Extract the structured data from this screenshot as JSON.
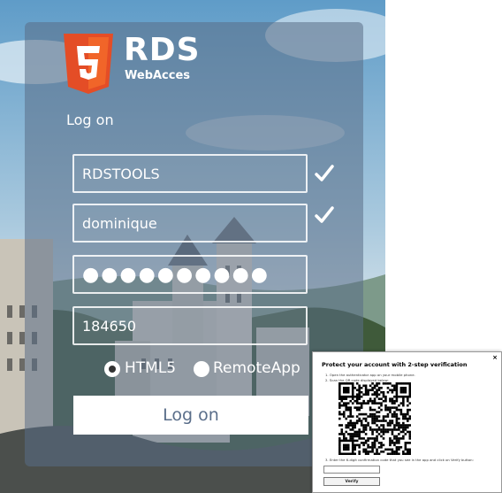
{
  "brand": {
    "title": "RDS",
    "subtitle": "WebAcces",
    "logo_icon": "html5-shield-icon",
    "logo_color": "#e44d26"
  },
  "login": {
    "heading": "Log on",
    "domain_value": "RDSTOOLS",
    "username_value": "dominique",
    "password_value": "●●●●●●●●●●",
    "code_value": "184650",
    "check_icon": "checkmark-icon",
    "radio_options": [
      {
        "label": "HTML5",
        "selected": true
      },
      {
        "label": "RemoteApp",
        "selected": false
      }
    ],
    "submit_label": "Log on"
  },
  "two_step": {
    "title": "Protect your account with 2-step verification",
    "close_label": "×",
    "steps": [
      "1. Open the authenticator app on your mobile phone.",
      "2. Scan the QR code displayed below:",
      "3. Enter the 6-digit confirmation code that you see in the app and click on Verify button:"
    ],
    "qr_icon": "qr-code-icon",
    "input_value": "",
    "verify_label": "Verify"
  }
}
